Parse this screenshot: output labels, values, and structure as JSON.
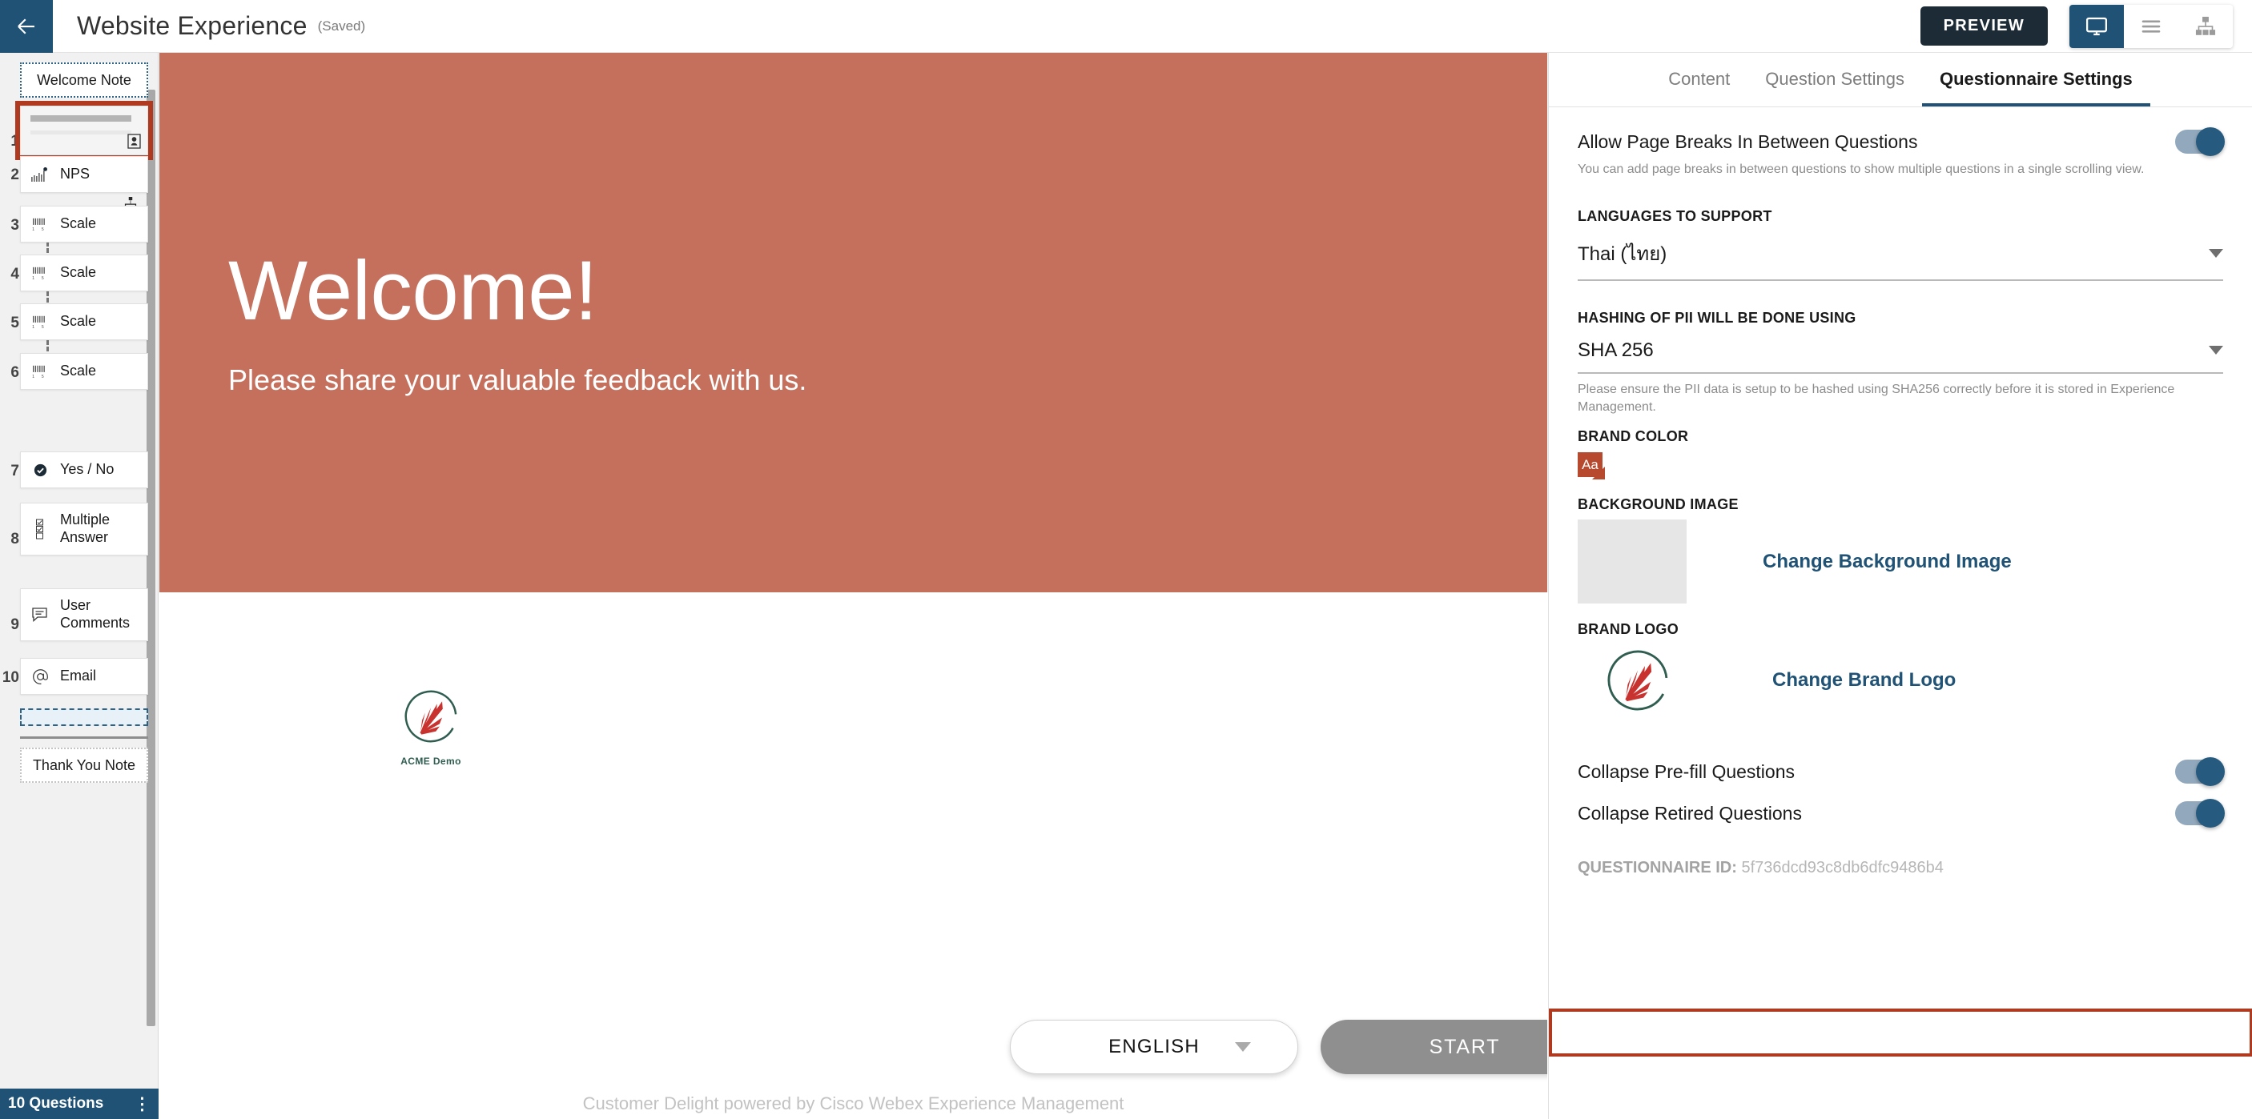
{
  "topbar": {
    "back_icon": "arrow-left-icon",
    "title": "Website Experience",
    "saved_label": "(Saved)",
    "preview_label": "PREVIEW",
    "view_buttons": [
      {
        "icon": "monitor-icon",
        "name": "desktop-view",
        "active": true
      },
      {
        "icon": "list-icon",
        "name": "list-view",
        "active": false
      },
      {
        "icon": "sitemap-icon",
        "name": "flow-view",
        "active": false
      }
    ]
  },
  "sidebar": {
    "welcome_note": "Welcome Note",
    "thank_you_note": "Thank You Note",
    "footer_count": "10 Questions",
    "footer_menu_icon": "vertical-dots-icon",
    "items": [
      {
        "num": "1",
        "label": "",
        "icon": "badge-card-icon",
        "type": "blank",
        "selected": true
      },
      {
        "num": "2",
        "label": "NPS",
        "icon": "nps-bars-icon",
        "type": "question"
      },
      {
        "num": "3",
        "label": "Scale",
        "icon": "scale-icon",
        "type": "question"
      },
      {
        "num": "4",
        "label": "Scale",
        "icon": "scale-icon",
        "type": "question"
      },
      {
        "num": "5",
        "label": "Scale",
        "icon": "scale-icon",
        "type": "question"
      },
      {
        "num": "6",
        "label": "Scale",
        "icon": "scale-icon",
        "type": "question"
      },
      {
        "num": "7",
        "label": "Yes / No",
        "icon": "check-badge-icon",
        "type": "question"
      },
      {
        "num": "8",
        "label": "Multiple Answer",
        "icon": "checklist-icon",
        "type": "question"
      },
      {
        "num": "9",
        "label": "User Comments",
        "icon": "comment-icon",
        "type": "question"
      },
      {
        "num": "10",
        "label": "Email",
        "icon": "at-sign-icon",
        "type": "question"
      }
    ]
  },
  "preview": {
    "hero_title": "Welcome!",
    "hero_subtitle": "Please share your valuable feedback with us.",
    "hero_bg_color": "#c4705d",
    "brand_name": "ACME Demo",
    "language_value": "ENGLISH",
    "start_label": "START",
    "powered_by": "Customer Delight powered by Cisco Webex Experience Management"
  },
  "right_panel": {
    "tabs": [
      {
        "label": "Content",
        "active": false
      },
      {
        "label": "Question Settings",
        "active": false
      },
      {
        "label": "Questionnaire Settings",
        "active": true
      }
    ],
    "page_breaks": {
      "label": "Allow Page Breaks In Between Questions",
      "help": "You can add page breaks in between questions to show multiple questions in a single scrolling view.",
      "enabled": true
    },
    "languages": {
      "label": "LANGUAGES TO SUPPORT",
      "value": "Thai (ไทย)"
    },
    "hashing": {
      "label": "HASHING OF PII WILL BE DONE USING",
      "value": "SHA 256",
      "help": "Please ensure the PII data is setup to be hashed using SHA256 correctly before it is stored in Experience Management."
    },
    "brand_color": {
      "label": "BRAND COLOR",
      "swatch_text": "Aa",
      "color": "#b6492e"
    },
    "background_image": {
      "label": "BACKGROUND IMAGE",
      "change_label": "Change Background Image"
    },
    "brand_logo": {
      "label": "BRAND LOGO",
      "change_label": "Change Brand Logo"
    },
    "collapse_prefill": {
      "label": "Collapse Pre-fill Questions",
      "enabled": true,
      "highlighted": true
    },
    "collapse_retired": {
      "label": "Collapse Retired Questions",
      "enabled": true
    },
    "questionnaire_id_label": "QUESTIONNAIRE ID:",
    "questionnaire_id_value": "5f736dcd93c8db6dfc9486b4"
  }
}
